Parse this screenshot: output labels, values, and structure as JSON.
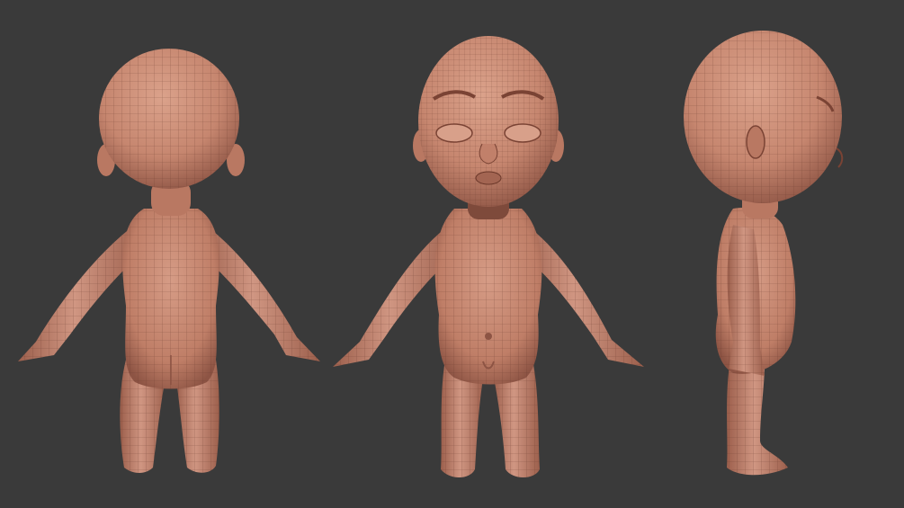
{
  "scene": {
    "background_color": "#3a3a3a",
    "skin_color": "#c6866f",
    "skin_shadow_color": "#8d5444",
    "skin_highlight_color": "#dba28b",
    "wire_color": "#5e3326",
    "views": [
      {
        "name": "back-view"
      },
      {
        "name": "front-view"
      },
      {
        "name": "side-view"
      }
    ]
  }
}
